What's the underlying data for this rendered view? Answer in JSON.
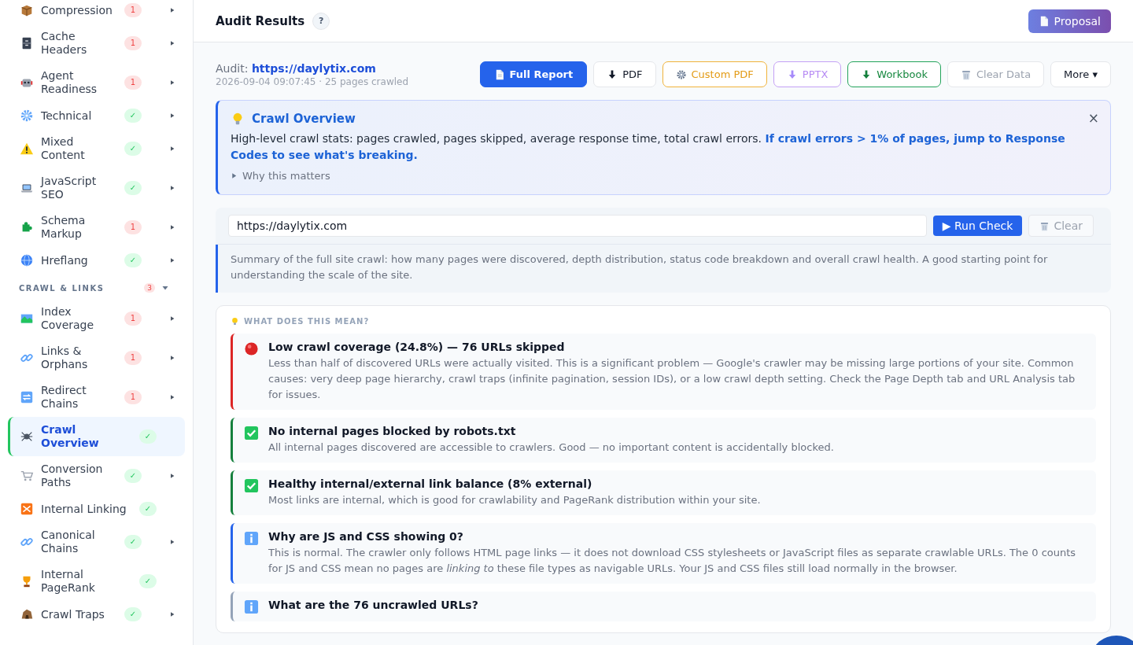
{
  "sidebar": {
    "items": [
      {
        "label": "Compression",
        "badge": "1",
        "passed": false,
        "expandable": true,
        "selected": false
      },
      {
        "label": "Cache Headers",
        "badge": "1",
        "passed": false,
        "expandable": true,
        "selected": false
      },
      {
        "label": "Agent Readiness",
        "badge": "1",
        "passed": false,
        "expandable": true,
        "selected": false
      },
      {
        "label": "Technical",
        "badge": "✓",
        "passed": true,
        "expandable": true,
        "selected": false
      },
      {
        "label": "Mixed Content",
        "badge": "✓",
        "passed": true,
        "expandable": true,
        "selected": false
      },
      {
        "label": "JavaScript SEO",
        "badge": "✓",
        "passed": true,
        "expandable": true,
        "selected": false
      },
      {
        "label": "Schema Markup",
        "badge": "1",
        "passed": false,
        "expandable": true,
        "selected": false
      },
      {
        "label": "Hreflang",
        "badge": "✓",
        "passed": true,
        "expandable": true,
        "selected": false
      },
      {
        "kind": "section",
        "label": "CRAWL & LINKS",
        "badge": "3",
        "expanded": true
      },
      {
        "label": "Index Coverage",
        "badge": "1",
        "passed": false,
        "expandable": true,
        "selected": false
      },
      {
        "label": "Links & Orphans",
        "badge": "1",
        "passed": false,
        "expandable": true,
        "selected": false
      },
      {
        "label": "Redirect Chains",
        "badge": "1",
        "passed": false,
        "expandable": true,
        "selected": false
      },
      {
        "label": "Crawl Overview",
        "badge": "✓",
        "passed": true,
        "expandable": false,
        "selected": true
      },
      {
        "label": "Conversion Paths",
        "badge": "✓",
        "passed": true,
        "expandable": true,
        "selected": false
      },
      {
        "label": "Internal Linking",
        "badge": "✓",
        "passed": true,
        "expandable": false,
        "selected": false
      },
      {
        "label": "Canonical Chains",
        "badge": "✓",
        "passed": true,
        "expandable": true,
        "selected": false
      },
      {
        "label": "Internal PageRank",
        "badge": "✓",
        "passed": true,
        "expandable": false,
        "selected": false
      },
      {
        "label": "Crawl Traps",
        "badge": "✓",
        "passed": true,
        "expandable": true,
        "selected": false
      }
    ]
  },
  "header": {
    "title": "Audit Results",
    "help": "?",
    "proposal_button": "Proposal"
  },
  "audit": {
    "label": "Audit:",
    "url": "https://daylytix.com",
    "meta": "2026-09-04 09:07:45 · 25 pages crawled"
  },
  "actions": [
    {
      "kind": "report",
      "label": "Full Report"
    },
    {
      "kind": "download",
      "label": "PDF"
    },
    {
      "kind": "custom",
      "label": "Custom PDF"
    },
    {
      "kind": "slides",
      "label": "PPTX"
    },
    {
      "kind": "workbook",
      "label": "Workbook"
    },
    {
      "kind": "clear",
      "label": "Clear Data",
      "disabled": true
    },
    {
      "kind": "menu",
      "label": "More ▾"
    }
  ],
  "callout": {
    "title": "Crawl Overview",
    "text": "High-level crawl stats: pages crawled, pages skipped, average response time, total crawl errors. **If crawl errors > 1% of pages, jump to Response Codes to see what's breaking.**",
    "toggle": "Why this matters",
    "expanded": false,
    "close": "×"
  },
  "check": {
    "url": "https://daylytix.com",
    "run_button": "▶ Run Check",
    "clear_button": "Clear",
    "clear_disabled": true,
    "description": "Summary of the full site crawl: how many pages were discovered, depth distribution, status code breakdown and overall crawl health. A good starting point for understanding the scale of the site."
  },
  "findings": {
    "heading": "WHAT DOES THIS MEAN?",
    "items": [
      {
        "kind": "error",
        "title": "Low crawl coverage (24.8%) — 76 URLs skipped",
        "text": "Less than half of discovered URLs were actually visited. This is a significant problem — Google's crawler may be missing large portions of your site. Common causes: very deep page hierarchy, crawl traps (infinite pagination, session IDs), or a low crawl depth setting. Check the Page Depth tab and URL Analysis tab for issues."
      },
      {
        "kind": "ok",
        "title": "No internal pages blocked by robots.txt",
        "text": "All internal pages discovered are accessible to crawlers. Good — no important content is accidentally blocked."
      },
      {
        "kind": "ok",
        "title": "Healthy internal/external link balance (8% external)",
        "text": "Most links are internal, which is good for crawlability and PageRank distribution within your site."
      },
      {
        "kind": "info",
        "title": "Why are JS and CSS showing 0?",
        "text": "This is normal. The crawler only follows HTML page links — it does not download CSS stylesheets or JavaScript files as separate crawlable URLs. The 0 counts for JS and CSS mean no pages are *linking to* these file types as navigable URLs. Your JS and CSS files still load normally in the browser."
      },
      {
        "kind": "note",
        "title": "What are the 76 uncrawled URLs?"
      }
    ]
  }
}
